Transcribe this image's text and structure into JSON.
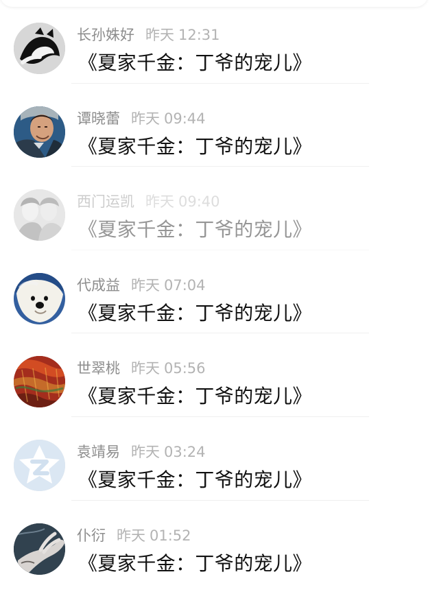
{
  "messages": [
    {
      "username": "长孙姝好",
      "date": "昨天",
      "time": "12:31",
      "title": "《夏家千金：丁爷的宠儿》",
      "avatar_icon": "cat-avatar",
      "dimmed": false
    },
    {
      "username": "谭晓蕾",
      "date": "昨天",
      "time": "09:44",
      "title": "《夏家千金：丁爷的宠儿》",
      "avatar_icon": "officer-avatar",
      "dimmed": false
    },
    {
      "username": "西门运凯",
      "date": "昨天",
      "time": "09:40",
      "title": "《夏家千金：丁爷的宠儿》",
      "avatar_icon": "couple-avatar",
      "dimmed": true
    },
    {
      "username": "代成益",
      "date": "昨天",
      "time": "07:04",
      "title": "《夏家千金：丁爷的宠儿》",
      "avatar_icon": "dog-avatar",
      "dimmed": false
    },
    {
      "username": "世翠桃",
      "date": "昨天",
      "time": "05:56",
      "title": "《夏家千金：丁爷的宠儿》",
      "avatar_icon": "painting-avatar",
      "dimmed": false
    },
    {
      "username": "袁靖易",
      "date": "昨天",
      "time": "03:24",
      "title": "《夏家千金：丁爷的宠儿》",
      "avatar_icon": "star-logo-avatar",
      "dimmed": false
    },
    {
      "username": "仆衍",
      "date": "昨天",
      "time": "01:52",
      "title": "《夏家千金：丁爷的宠儿》",
      "avatar_icon": "hand-avatar",
      "dimmed": false
    }
  ],
  "colors": {
    "background": "#ffffff",
    "title": "#111111",
    "username": "#8d8d8d",
    "timestamp": "#b3b3b3",
    "separator": "#efefef",
    "placeholder_avatar": "#dbe7f3"
  }
}
